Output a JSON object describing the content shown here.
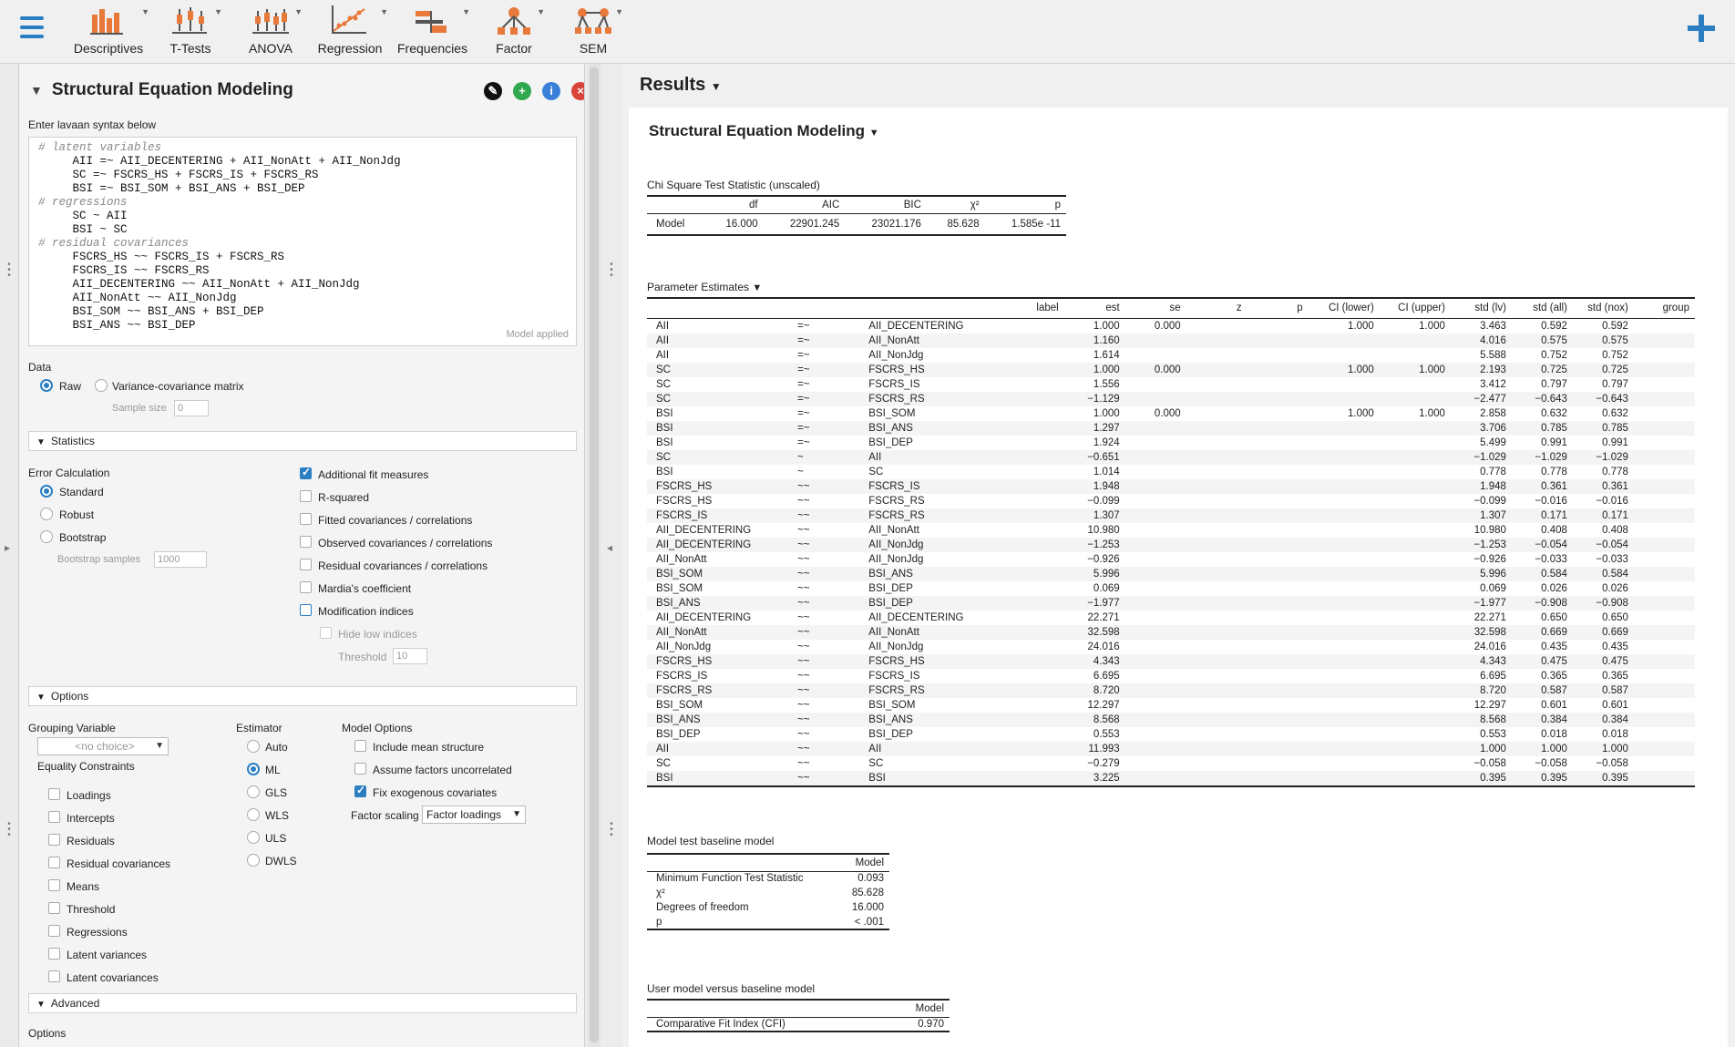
{
  "ribbon": {
    "items": [
      {
        "label": "Descriptives",
        "icon": "descriptives-icon"
      },
      {
        "label": "T-Tests",
        "icon": "t-tests-icon"
      },
      {
        "label": "ANOVA",
        "icon": "anova-icon"
      },
      {
        "label": "Regression",
        "icon": "regression-icon"
      },
      {
        "label": "Frequencies",
        "icon": "frequencies-icon"
      },
      {
        "label": "Factor",
        "icon": "factor-icon"
      },
      {
        "label": "SEM",
        "icon": "sem-icon"
      }
    ]
  },
  "colors": {
    "accent": "#2b7ec2",
    "green": "#2fa84f",
    "red": "#d9433a",
    "info": "#3a80d9"
  },
  "analysis": {
    "title": "Structural Equation Modeling",
    "syntax_label": "Enter lavaan syntax below",
    "syntax_lines": [
      "# latent variables",
      "     AII =~ AII_DECENTERING + AII_NonAtt + AII_NonJdg",
      "     SC =~ FSCRS_HS + FSCRS_IS + FSCRS_RS",
      "     BSI =~ BSI_SOM + BSI_ANS + BSI_DEP",
      "# regressions",
      "     SC ~ AII",
      "     BSI ~ SC",
      "# residual covariances",
      "     FSCRS_HS ~~ FSCRS_IS + FSCRS_RS",
      "     FSCRS_IS ~~ FSCRS_RS",
      "     AII_DECENTERING ~~ AII_NonAtt + AII_NonJdg",
      "     AII_NonAtt ~~ AII_NonJdg",
      "     BSI_SOM ~~ BSI_ANS + BSI_DEP",
      "     BSI_ANS ~~ BSI_DEP"
    ],
    "model_applied": "Model applied",
    "data_label": "Data",
    "raw": "Raw",
    "varcov": "Variance-covariance matrix",
    "sample_size_label": "Sample size",
    "sample_size": "0",
    "statistics": "Statistics",
    "error_calc": "Error Calculation",
    "standard": "Standard",
    "robust": "Robust",
    "bootstrap": "Bootstrap",
    "bootstrap_samples_label": "Bootstrap samples",
    "bootstrap_samples": "1000",
    "checks": [
      {
        "label": "Additional fit measures",
        "checked": true
      },
      {
        "label": "R-squared",
        "checked": false
      },
      {
        "label": "Fitted covariances / correlations",
        "checked": false
      },
      {
        "label": "Observed covariances / correlations",
        "checked": false
      },
      {
        "label": "Residual covariances / correlations",
        "checked": false
      },
      {
        "label": "Mardia's coefficient",
        "checked": false
      },
      {
        "label": "Modification indices",
        "checked": false
      }
    ],
    "hide_low": "Hide low indices",
    "threshold_label": "Threshold",
    "threshold": "10",
    "options": "Options",
    "grouping_var": "Grouping Variable",
    "no_choice": "<no choice>",
    "equality": "Equality Constraints",
    "eq_items": [
      "Loadings",
      "Intercepts",
      "Residuals",
      "Residual covariances",
      "Means",
      "Threshold",
      "Regressions",
      "Latent variances",
      "Latent covariances"
    ],
    "estimator": "Estimator",
    "est_items": [
      "Auto",
      "ML",
      "GLS",
      "WLS",
      "ULS",
      "DWLS"
    ],
    "model_options": "Model Options",
    "mo_items": [
      {
        "label": "Include mean structure",
        "checked": false
      },
      {
        "label": "Assume factors uncorrelated",
        "checked": false
      },
      {
        "label": "Fix exogenous covariates",
        "checked": true
      }
    ],
    "factor_scaling_label": "Factor scaling",
    "factor_scaling": "Factor loadings",
    "advanced": "Advanced",
    "options_bottom": "Options"
  },
  "results": {
    "title": "Results",
    "sem_title": "Structural Equation Modeling",
    "chi": {
      "caption": "Chi Square Test Statistic (unscaled)",
      "headers": [
        "",
        "df",
        "AIC",
        "BIC",
        "χ²",
        "p"
      ],
      "row": [
        "Model",
        "16.000",
        "22901.245",
        "23021.176",
        "85.628",
        "1.585e -11"
      ]
    },
    "pe": {
      "caption": "Parameter Estimates",
      "headers": [
        "",
        "",
        "",
        "label",
        "est",
        "se",
        "z",
        "p",
        "CI (lower)",
        "CI (upper)",
        "std (lv)",
        "std (all)",
        "std (nox)",
        "group"
      ],
      "rows": [
        [
          "AII",
          "=~",
          "AII_DECENTERING",
          "",
          "1.000",
          "0.000",
          "",
          "",
          "1.000",
          "1.000",
          "3.463",
          "0.592",
          "0.592",
          ""
        ],
        [
          "AII",
          "=~",
          "AII_NonAtt",
          "",
          "1.160",
          "",
          "",
          "",
          "",
          "",
          "4.016",
          "0.575",
          "0.575",
          ""
        ],
        [
          "AII",
          "=~",
          "AII_NonJdg",
          "",
          "1.614",
          "",
          "",
          "",
          "",
          "",
          "5.588",
          "0.752",
          "0.752",
          ""
        ],
        [
          "SC",
          "=~",
          "FSCRS_HS",
          "",
          "1.000",
          "0.000",
          "",
          "",
          "1.000",
          "1.000",
          "2.193",
          "0.725",
          "0.725",
          ""
        ],
        [
          "SC",
          "=~",
          "FSCRS_IS",
          "",
          "1.556",
          "",
          "",
          "",
          "",
          "",
          "3.412",
          "0.797",
          "0.797",
          ""
        ],
        [
          "SC",
          "=~",
          "FSCRS_RS",
          "",
          "−1.129",
          "",
          "",
          "",
          "",
          "",
          "−2.477",
          "−0.643",
          "−0.643",
          ""
        ],
        [
          "BSI",
          "=~",
          "BSI_SOM",
          "",
          "1.000",
          "0.000",
          "",
          "",
          "1.000",
          "1.000",
          "2.858",
          "0.632",
          "0.632",
          ""
        ],
        [
          "BSI",
          "=~",
          "BSI_ANS",
          "",
          "1.297",
          "",
          "",
          "",
          "",
          "",
          "3.706",
          "0.785",
          "0.785",
          ""
        ],
        [
          "BSI",
          "=~",
          "BSI_DEP",
          "",
          "1.924",
          "",
          "",
          "",
          "",
          "",
          "5.499",
          "0.991",
          "0.991",
          ""
        ],
        [
          "SC",
          "~",
          "AII",
          "",
          "−0.651",
          "",
          "",
          "",
          "",
          "",
          "−1.029",
          "−1.029",
          "−1.029",
          ""
        ],
        [
          "BSI",
          "~",
          "SC",
          "",
          "1.014",
          "",
          "",
          "",
          "",
          "",
          "0.778",
          "0.778",
          "0.778",
          ""
        ],
        [
          "FSCRS_HS",
          "~~",
          "FSCRS_IS",
          "",
          "1.948",
          "",
          "",
          "",
          "",
          "",
          "1.948",
          "0.361",
          "0.361",
          ""
        ],
        [
          "FSCRS_HS",
          "~~",
          "FSCRS_RS",
          "",
          "−0.099",
          "",
          "",
          "",
          "",
          "",
          "−0.099",
          "−0.016",
          "−0.016",
          ""
        ],
        [
          "FSCRS_IS",
          "~~",
          "FSCRS_RS",
          "",
          "1.307",
          "",
          "",
          "",
          "",
          "",
          "1.307",
          "0.171",
          "0.171",
          ""
        ],
        [
          "AII_DECENTERING",
          "~~",
          "AII_NonAtt",
          "",
          "10.980",
          "",
          "",
          "",
          "",
          "",
          "10.980",
          "0.408",
          "0.408",
          ""
        ],
        [
          "AII_DECENTERING",
          "~~",
          "AII_NonJdg",
          "",
          "−1.253",
          "",
          "",
          "",
          "",
          "",
          "−1.253",
          "−0.054",
          "−0.054",
          ""
        ],
        [
          "AII_NonAtt",
          "~~",
          "AII_NonJdg",
          "",
          "−0.926",
          "",
          "",
          "",
          "",
          "",
          "−0.926",
          "−0.033",
          "−0.033",
          ""
        ],
        [
          "BSI_SOM",
          "~~",
          "BSI_ANS",
          "",
          "5.996",
          "",
          "",
          "",
          "",
          "",
          "5.996",
          "0.584",
          "0.584",
          ""
        ],
        [
          "BSI_SOM",
          "~~",
          "BSI_DEP",
          "",
          "0.069",
          "",
          "",
          "",
          "",
          "",
          "0.069",
          "0.026",
          "0.026",
          ""
        ],
        [
          "BSI_ANS",
          "~~",
          "BSI_DEP",
          "",
          "−1.977",
          "",
          "",
          "",
          "",
          "",
          "−1.977",
          "−0.908",
          "−0.908",
          ""
        ],
        [
          "AII_DECENTERING",
          "~~",
          "AII_DECENTERING",
          "",
          "22.271",
          "",
          "",
          "",
          "",
          "",
          "22.271",
          "0.650",
          "0.650",
          ""
        ],
        [
          "AII_NonAtt",
          "~~",
          "AII_NonAtt",
          "",
          "32.598",
          "",
          "",
          "",
          "",
          "",
          "32.598",
          "0.669",
          "0.669",
          ""
        ],
        [
          "AII_NonJdg",
          "~~",
          "AII_NonJdg",
          "",
          "24.016",
          "",
          "",
          "",
          "",
          "",
          "24.016",
          "0.435",
          "0.435",
          ""
        ],
        [
          "FSCRS_HS",
          "~~",
          "FSCRS_HS",
          "",
          "4.343",
          "",
          "",
          "",
          "",
          "",
          "4.343",
          "0.475",
          "0.475",
          ""
        ],
        [
          "FSCRS_IS",
          "~~",
          "FSCRS_IS",
          "",
          "6.695",
          "",
          "",
          "",
          "",
          "",
          "6.695",
          "0.365",
          "0.365",
          ""
        ],
        [
          "FSCRS_RS",
          "~~",
          "FSCRS_RS",
          "",
          "8.720",
          "",
          "",
          "",
          "",
          "",
          "8.720",
          "0.587",
          "0.587",
          ""
        ],
        [
          "BSI_SOM",
          "~~",
          "BSI_SOM",
          "",
          "12.297",
          "",
          "",
          "",
          "",
          "",
          "12.297",
          "0.601",
          "0.601",
          ""
        ],
        [
          "BSI_ANS",
          "~~",
          "BSI_ANS",
          "",
          "8.568",
          "",
          "",
          "",
          "",
          "",
          "8.568",
          "0.384",
          "0.384",
          ""
        ],
        [
          "BSI_DEP",
          "~~",
          "BSI_DEP",
          "",
          "0.553",
          "",
          "",
          "",
          "",
          "",
          "0.553",
          "0.018",
          "0.018",
          ""
        ],
        [
          "AII",
          "~~",
          "AII",
          "",
          "11.993",
          "",
          "",
          "",
          "",
          "",
          "1.000",
          "1.000",
          "1.000",
          ""
        ],
        [
          "SC",
          "~~",
          "SC",
          "",
          "−0.279",
          "",
          "",
          "",
          "",
          "",
          "−0.058",
          "−0.058",
          "−0.058",
          ""
        ],
        [
          "BSI",
          "~~",
          "BSI",
          "",
          "3.225",
          "",
          "",
          "",
          "",
          "",
          "0.395",
          "0.395",
          "0.395",
          ""
        ]
      ]
    },
    "baseline": {
      "caption": "Model test baseline model",
      "header": "Model",
      "rows": [
        [
          "Minimum Function Test Statistic",
          "0.093"
        ],
        [
          "χ²",
          "85.628"
        ],
        [
          "Degrees of freedom",
          "16.000"
        ],
        [
          "p",
          "< .001"
        ]
      ]
    },
    "user_vs_base": {
      "caption": "User model versus baseline model",
      "header": "Model",
      "rows": [
        [
          "Comparative Fit Index (CFI)",
          "0.970"
        ]
      ]
    }
  }
}
